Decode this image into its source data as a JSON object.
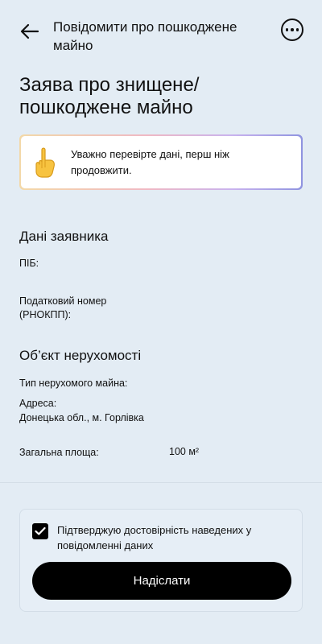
{
  "header": {
    "title": "Повідомити про пошкоджене майно",
    "back_icon": "arrow-left-icon",
    "more_icon": "more-horizontal-icon"
  },
  "page": {
    "title": "Заява про знищене/ пошкоджене майно"
  },
  "notice": {
    "icon": "pointing-finger-emoji",
    "text": "Уважно перевірте дані, перш ніж продовжити."
  },
  "applicant": {
    "section_title": "Дані заявника",
    "full_name_label": "ПІБ:",
    "tax_number_label": "Податковий номер (РНОКПП):"
  },
  "property": {
    "section_title": "Об’єкт нерухомості",
    "type_label": "Тип нерухомого майна:",
    "address_label": "Адреса:",
    "address_value": "Донецька обл., м. Горлівка",
    "area_label": "Загальна площа:",
    "area_value": "100 м²"
  },
  "confirm": {
    "checked": true,
    "text": "Підтверджую достовірність наведених у повідомленні даних",
    "submit_label": "Надіслати"
  },
  "colors": {
    "background": "#e3ecf4",
    "primary": "#000000",
    "on_primary": "#ffffff"
  }
}
